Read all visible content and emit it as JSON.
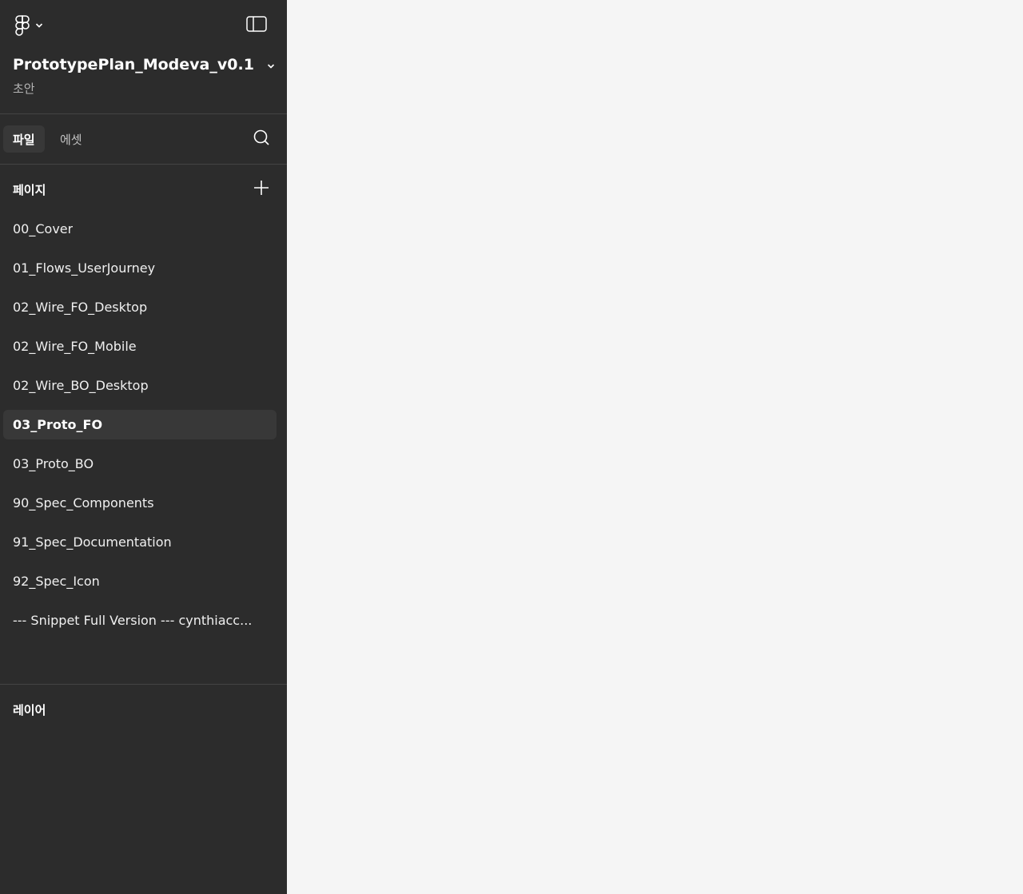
{
  "app": {
    "menu_icon": "figma-logo-icon",
    "panel_toggle_icon": "sidebar-panel-icon"
  },
  "file": {
    "title": "PrototypePlan_Modeva_v0.1",
    "status": "초안"
  },
  "tabs": [
    {
      "label": "파일",
      "active": true
    },
    {
      "label": "에셋",
      "active": false
    }
  ],
  "pages_section": {
    "heading": "페이지",
    "selected_index": 5,
    "items": [
      "00_Cover",
      "01_Flows_UserJourney",
      "02_Wire_FO_Desktop",
      "02_Wire_FO_Mobile",
      "02_Wire_BO_Desktop",
      "03_Proto_FO",
      "03_Proto_BO",
      "90_Spec_Components",
      "91_Spec_Documentation",
      "92_Spec_Icon",
      "--- Snippet Full Version --- cynthiacc..."
    ]
  },
  "layers_section": {
    "heading": "레이어"
  },
  "colors": {
    "sidebar_bg": "#2c2c2c",
    "canvas_bg": "#f5f5f5",
    "selected_bg": "#383838",
    "divider": "#444444"
  }
}
